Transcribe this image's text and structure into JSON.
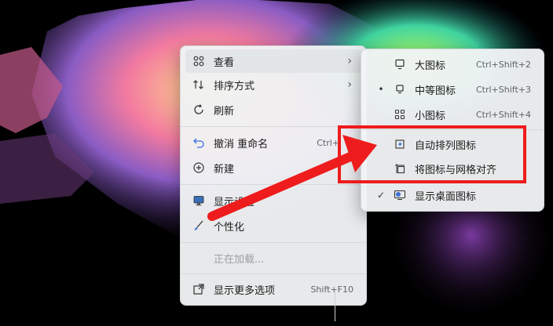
{
  "main_menu": {
    "items": [
      {
        "label": "查看",
        "icon": "grid-icon"
      },
      {
        "label": "排序方式",
        "icon": "sort-icon"
      },
      {
        "label": "刷新",
        "icon": "refresh-icon"
      },
      {
        "label": "撤消 重命名",
        "shortcut": "Ctrl+",
        "icon": "undo-icon"
      },
      {
        "label": "新建",
        "icon": "plus-circle-icon"
      },
      {
        "label": "显示设置",
        "icon": "display-icon"
      },
      {
        "label": "个性化",
        "icon": "brush-icon"
      },
      {
        "label": "正在加载...",
        "icon": ""
      },
      {
        "label": "显示更多选项",
        "shortcut": "Shift+F10",
        "icon": "more-options-icon"
      }
    ]
  },
  "sub_menu": {
    "items": [
      {
        "label": "大图标",
        "shortcut": "Ctrl+Shift+2",
        "icon": "monitor-large-icon"
      },
      {
        "label": "中等图标",
        "shortcut": "Ctrl+Shift+3",
        "icon": "monitor-medium-icon",
        "selected": "•"
      },
      {
        "label": "小图标",
        "shortcut": "Ctrl+Shift+4",
        "icon": "small-grid-icon"
      },
      {
        "label": "自动排列图标",
        "icon": "auto-arrange-icon"
      },
      {
        "label": "将图标与网格对齐",
        "icon": "align-grid-icon"
      },
      {
        "label": "显示桌面图标",
        "icon": "desktop-icon",
        "checked": "✓"
      }
    ]
  },
  "annotation": {
    "color": "#ee1c1c"
  }
}
